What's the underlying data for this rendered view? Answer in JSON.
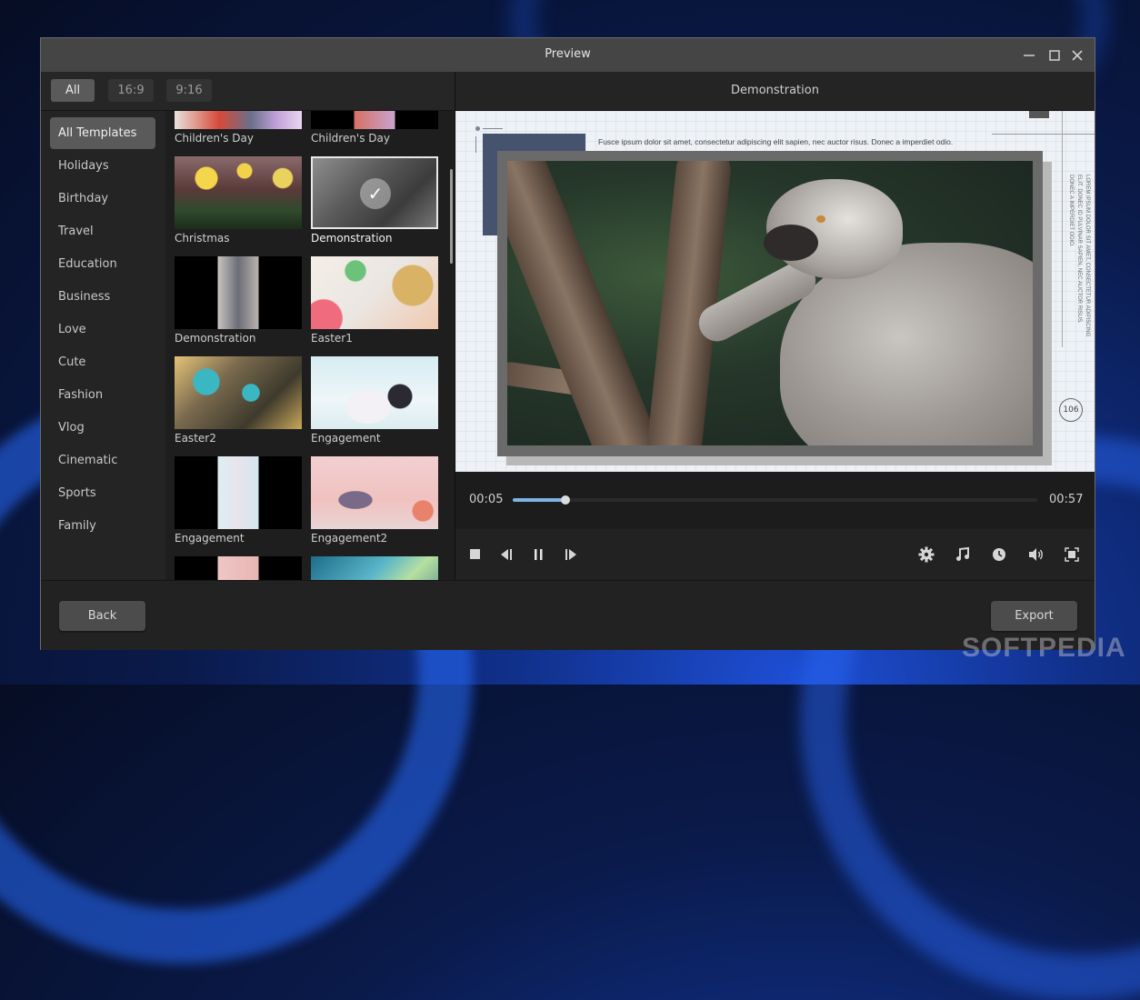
{
  "window": {
    "title": "Preview",
    "controls": [
      "minimize",
      "maximize",
      "close"
    ]
  },
  "filters": {
    "items": [
      {
        "label": "All",
        "active": true
      },
      {
        "label": "16:9",
        "active": false
      },
      {
        "label": "9:16",
        "active": false
      }
    ]
  },
  "categories": [
    {
      "label": "All Templates",
      "active": true
    },
    {
      "label": "Holidays"
    },
    {
      "label": "Birthday"
    },
    {
      "label": "Travel"
    },
    {
      "label": "Education"
    },
    {
      "label": "Business"
    },
    {
      "label": "Love"
    },
    {
      "label": "Cute"
    },
    {
      "label": "Fashion"
    },
    {
      "label": "Vlog"
    },
    {
      "label": "Cinematic"
    },
    {
      "label": "Sports"
    },
    {
      "label": "Family"
    }
  ],
  "templates": [
    {
      "label": "Children's Day",
      "aspect": "16:9"
    },
    {
      "label": "Children's Day",
      "aspect": "9:16"
    },
    {
      "label": "Christmas",
      "aspect": "16:9"
    },
    {
      "label": "Demonstration",
      "aspect": "16:9",
      "selected": true
    },
    {
      "label": "Demonstration",
      "aspect": "9:16"
    },
    {
      "label": "Easter1",
      "aspect": "16:9"
    },
    {
      "label": "Easter2",
      "aspect": "16:9"
    },
    {
      "label": "Engagement",
      "aspect": "16:9"
    },
    {
      "label": "Engagement",
      "aspect": "9:16"
    },
    {
      "label": "Engagement2",
      "aspect": "16:9"
    },
    {
      "label": "",
      "aspect": "9:16"
    },
    {
      "label": "",
      "aspect": "16:9"
    }
  ],
  "preview": {
    "title": "Demonstration",
    "overlay_text": "Fusce ipsum dolor sit amet, consectetur adipiscing elit  sapien, nec auctor risus. Donec a imperdiet odio.",
    "vertical_text": "LOREM IPSUM DOLOR SIT AMET, CONSECTETUR ADIPISCING ELIT. DONEC ID PULVINAR SAPIEN, NEC AUCTOR RISUS. DONEC A IMPERDIET ODIO.",
    "badge": "106"
  },
  "player": {
    "current_time": "00:05",
    "total_time": "00:57",
    "progress": 0.1,
    "progress_color": "#7cb4e4",
    "left_controls": [
      "stop-icon",
      "previous-frame-icon",
      "pause-icon",
      "next-frame-icon"
    ],
    "right_controls": [
      "settings-icon",
      "music-icon",
      "clock-icon",
      "volume-icon",
      "fullscreen-icon"
    ]
  },
  "footer": {
    "back_label": "Back",
    "export_label": "Export"
  },
  "watermark": "SOFTPEDIA"
}
